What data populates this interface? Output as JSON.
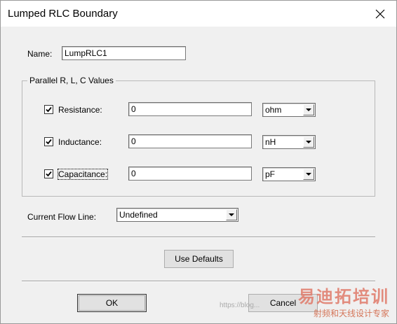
{
  "window": {
    "title": "Lumped RLC Boundary",
    "close_symbol": "✕"
  },
  "name_field": {
    "label": "Name:",
    "value": "LumpRLC1"
  },
  "group": {
    "title": "Parallel R, L, C Values",
    "rows": [
      {
        "label": "Resistance:",
        "checked": true,
        "value": "0",
        "unit": "ohm"
      },
      {
        "label": "Inductance:",
        "checked": true,
        "value": "0",
        "unit": "nH"
      },
      {
        "label": "Capacitance:",
        "checked": true,
        "value": "0",
        "unit": "pF"
      }
    ]
  },
  "current_flow": {
    "label": "Current Flow Line:",
    "value": "Undefined"
  },
  "buttons": {
    "use_defaults": "Use Defaults",
    "ok": "OK",
    "cancel": "Cancel"
  },
  "watermark": {
    "big": "易迪拓培训",
    "small": "射频和天线设计专家",
    "url": "https://blog..."
  }
}
